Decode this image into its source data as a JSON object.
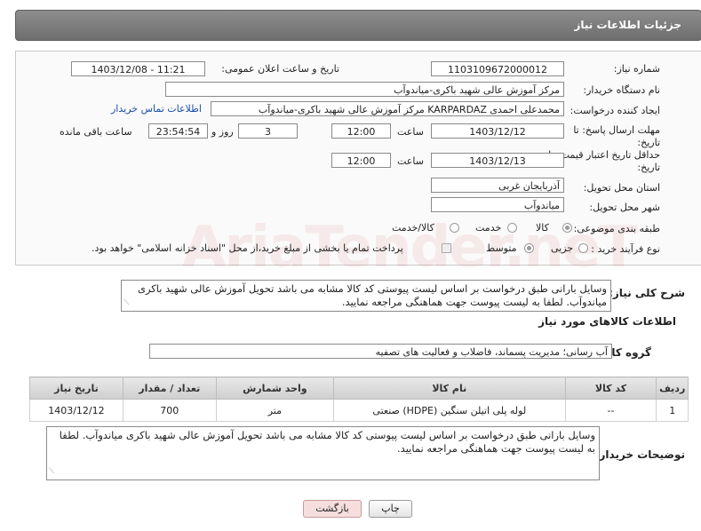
{
  "header": {
    "title": "جزئیات اطلاعات نیاز"
  },
  "form": {
    "need_number_label": "شماره نیاز:",
    "need_number": "1103109672000012",
    "announce_label": "تاریخ و ساعت اعلان عمومی:",
    "announce_value": "1403/12/08 - 11:21",
    "buyer_org_label": "نام دستگاه خریدار:",
    "buyer_org": "مرکز آموزش عالی شهید باکری-میاندوآب",
    "creator_label": "ایجاد کننده درخواست:",
    "creator": "محمدعلی احمدی KARPARDAZ مرکز آموزش عالی شهید باکری-میاندوآب",
    "contact_link": "اطلاعات تماس خریدار",
    "deadline_label_1": "مهلت ارسال پاسخ: تا",
    "deadline_label_2": "تاریخ:",
    "deadline_date": "1403/12/12",
    "time_label": "ساعت",
    "deadline_time": "12:00",
    "days_value": "3",
    "days_label": "روز و",
    "remaining_time": "23:54:54",
    "remaining_label": "ساعت باقی مانده",
    "validity_label_1": "حداقل تاریخ اعتبار قیمت: تا",
    "validity_label_2": "تاریخ:",
    "validity_date": "1403/12/13",
    "validity_time": "12:00",
    "province_label": "استان محل تحویل:",
    "province": "آذربایجان غربی",
    "city_label": "شهر محل تحویل:",
    "city": "میاندوآب",
    "category_label": "طبقه بندی موضوعی:",
    "category_options": [
      "کالا",
      "خدمت",
      "کالا/خدمت"
    ],
    "process_label": "نوع فرآیند خرید :",
    "process_options": [
      "جزیی",
      "متوسط"
    ],
    "payment_note": "پرداخت تمام یا بخشی از مبلغ خرید،از محل \"اسناد خزانه اسلامی\" خواهد بود."
  },
  "description": {
    "label": "شرح کلی نیاز:",
    "text": "وسایل بارانی طبق درخواست بر اساس لیست پیوستی کد کالا مشابه می باشد تحویل آموزش عالی شهید باکری میاندوآب. لطفا به لیست پیوست جهت هماهنگی مراجعه نمایید."
  },
  "goods": {
    "section_title": "اطلاعات کالاهای مورد نیاز",
    "group_label": "گروه کالا:",
    "group_value": "آب رسانی؛ مدیریت پسماند، فاضلاب و فعالیت های تصفیه",
    "columns": [
      "ردیف",
      "کد کالا",
      "نام کالا",
      "واحد شمارش",
      "تعداد / مقدار",
      "تاریخ نیاز"
    ],
    "rows": [
      {
        "row": "1",
        "code": "--",
        "name": "لوله پلی اتیلن سنگین (HDPE) صنعتی",
        "unit": "متر",
        "qty": "700",
        "date": "1403/12/12"
      }
    ]
  },
  "buyer_notes": {
    "label": "توضیحات خریدار:",
    "text": "وسایل بارانی طبق درخواست بر اساس لیست پیوستی کد کالا مشابه می باشد تحویل آموزش عالی شهید باکری میاندوآب. لطفا به لیست پیوست جهت هماهنگی مراجعه نمایید."
  },
  "buttons": {
    "print": "چاپ",
    "back": "بازگشت"
  },
  "watermark": "AriaTender.neT"
}
